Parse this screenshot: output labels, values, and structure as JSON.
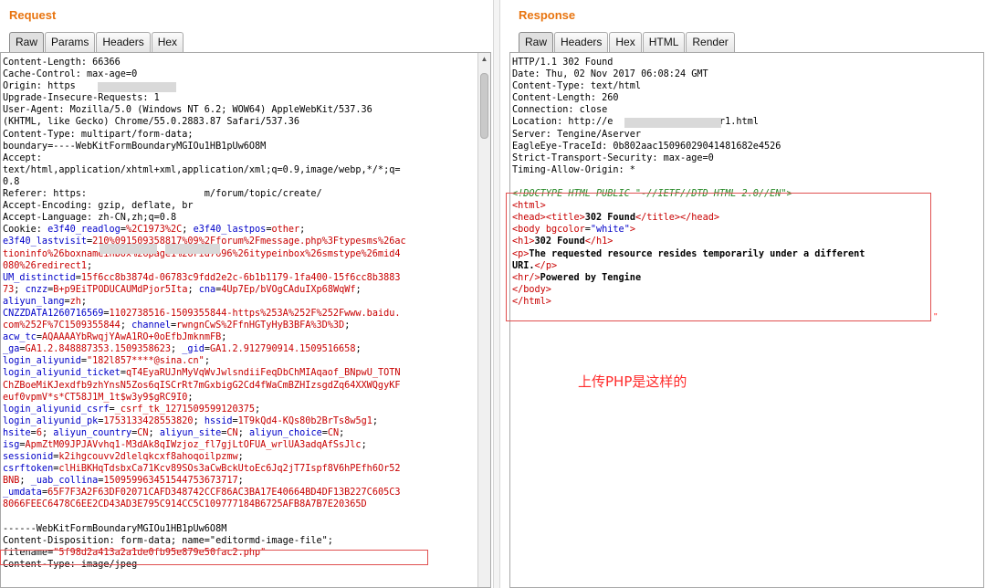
{
  "request": {
    "title": "Request",
    "tabs": [
      "Raw",
      "Params",
      "Headers",
      "Hex"
    ],
    "active_tab": "Raw",
    "lines": [
      [
        {
          "t": "Content-Length: 66366"
        }
      ],
      [
        {
          "t": "Cache-Control: max-age=0"
        }
      ],
      [
        {
          "t": "Origin: https          n.com"
        }
      ],
      [
        {
          "t": "Upgrade-Insecure-Requests: 1"
        }
      ],
      [
        {
          "t": "User-Agent: Mozilla/5.0 (Windows NT 6.2; WOW64) AppleWebKit/537.36"
        }
      ],
      [
        {
          "t": "(KHTML, like Gecko) Chrome/55.0.2883.87 Safari/537.36"
        }
      ],
      [
        {
          "t": "Content-Type: multipart/form-data;"
        }
      ],
      [
        {
          "t": "boundary=----WebKitFormBoundaryMGIOu1HB1pUw6O8M"
        }
      ],
      [
        {
          "t": "Accept:"
        }
      ],
      [
        {
          "t": "text/html,application/xhtml+xml,application/xml;q=0.9,image/webp,*/*;q="
        }
      ],
      [
        {
          "t": "0.8"
        }
      ],
      [
        {
          "t": "Referer: https:                     m/forum/topic/create/"
        }
      ],
      [
        {
          "t": "Accept-Encoding: gzip, deflate, br"
        }
      ],
      [
        {
          "t": "Accept-Language: zh-CN,zh;q=0.8"
        }
      ],
      [
        {
          "t": "Cookie: "
        },
        {
          "t": "e3f40_readlog",
          "c": "blue"
        },
        {
          "t": "=",
          "c": "k"
        },
        {
          "t": "%2C1973%2C",
          "c": "red"
        },
        {
          "t": "; "
        },
        {
          "t": "e3f40_lastpos",
          "c": "blue"
        },
        {
          "t": "="
        },
        {
          "t": "other",
          "c": "red"
        },
        {
          "t": ";"
        }
      ],
      [
        {
          "t": "e3f40_lastvisit",
          "c": "blue"
        },
        {
          "t": "="
        },
        {
          "t": "210%091509358817%09%2Fforum%2Fmessage.php%3Ftypesms%26ac",
          "c": "red"
        }
      ],
      [
        {
          "t": "tioninfo%26boxnameinbox%26page1%26rid7696%26itypeinbox%26smstype%26mid4",
          "c": "red"
        }
      ],
      [
        {
          "t": "080%26redirect1",
          "c": "red"
        },
        {
          "t": ";"
        }
      ],
      [
        {
          "t": "UM_distinctid",
          "c": "blue"
        },
        {
          "t": "="
        },
        {
          "t": "15f6cc8b3874d-06783c9fdd2e2c-6b1b1179-1fa400-15f6cc8b3883",
          "c": "red"
        }
      ],
      [
        {
          "t": "73",
          "c": "red"
        },
        {
          "t": "; "
        },
        {
          "t": "cnzz",
          "c": "blue"
        },
        {
          "t": "="
        },
        {
          "t": "B+p9EiTPODUCAUMdPjor5Ita",
          "c": "red"
        },
        {
          "t": "; "
        },
        {
          "t": "cna",
          "c": "blue"
        },
        {
          "t": "="
        },
        {
          "t": "4Up7Ep/bVOgCAduIXp68WqWf",
          "c": "red"
        },
        {
          "t": ";"
        }
      ],
      [
        {
          "t": "aliyun_lang",
          "c": "blue"
        },
        {
          "t": "="
        },
        {
          "t": "zh",
          "c": "red"
        },
        {
          "t": ";"
        }
      ],
      [
        {
          "t": "CNZZDATA1260716569",
          "c": "blue"
        },
        {
          "t": "="
        },
        {
          "t": "1102738516-1509355844-https%253A%252F%252Fwww.baidu.",
          "c": "red"
        }
      ],
      [
        {
          "t": "com%252F%7C1509355844",
          "c": "red"
        },
        {
          "t": "; "
        },
        {
          "t": "channel",
          "c": "blue"
        },
        {
          "t": "="
        },
        {
          "t": "rwngnCwS%2FfnHGTyHyB3BFA%3D%3D",
          "c": "red"
        },
        {
          "t": ";"
        }
      ],
      [
        {
          "t": "acw_tc",
          "c": "blue"
        },
        {
          "t": "="
        },
        {
          "t": "AQAAAAYbRwqjYAwA1RO+0oEfbJmknmFB",
          "c": "red"
        },
        {
          "t": ";"
        }
      ],
      [
        {
          "t": "_ga",
          "c": "blue"
        },
        {
          "t": "="
        },
        {
          "t": "GA1.2.848887353.1509358623",
          "c": "red"
        },
        {
          "t": "; "
        },
        {
          "t": "_gid",
          "c": "blue"
        },
        {
          "t": "="
        },
        {
          "t": "GA1.2.912790914.1509516658",
          "c": "red"
        },
        {
          "t": ";"
        }
      ],
      [
        {
          "t": "login_aliyunid",
          "c": "blue"
        },
        {
          "t": "="
        },
        {
          "t": "\"182l857****@sina.cn\"",
          "c": "red"
        },
        {
          "t": ";"
        }
      ],
      [
        {
          "t": "login_aliyunid_ticket",
          "c": "blue"
        },
        {
          "t": "="
        },
        {
          "t": "qT4EyaRUJnMyVqWvJwlsndiiFeqDbChMIAqaof_BNpwU_TOTN",
          "c": "red"
        }
      ],
      [
        {
          "t": "ChZBoeMiKJexdfb9zhYnsN5Zos6qISCrRt7mGxbigG2Cd4fWaCmBZHIzsgdZq64XXWQgyKF",
          "c": "red"
        }
      ],
      [
        {
          "t": "euf0vpmV*s*CT58J1M_1t$w3y9$gRC9I0",
          "c": "red"
        },
        {
          "t": ";"
        }
      ],
      [
        {
          "t": "login_aliyunid_csrf",
          "c": "blue"
        },
        {
          "t": "="
        },
        {
          "t": "_csrf_tk_1271509599120375",
          "c": "red"
        },
        {
          "t": ";"
        }
      ],
      [
        {
          "t": "login_aliyunid_pk",
          "c": "blue"
        },
        {
          "t": "="
        },
        {
          "t": "1753133428553820",
          "c": "red"
        },
        {
          "t": "; "
        },
        {
          "t": "hssid",
          "c": "blue"
        },
        {
          "t": "="
        },
        {
          "t": "1T9kQd4-KQs80b2BrTs8w5g1",
          "c": "red"
        },
        {
          "t": ";"
        }
      ],
      [
        {
          "t": "hsite",
          "c": "blue"
        },
        {
          "t": "="
        },
        {
          "t": "6",
          "c": "red"
        },
        {
          "t": "; "
        },
        {
          "t": "aliyun_country",
          "c": "blue"
        },
        {
          "t": "="
        },
        {
          "t": "CN",
          "c": "red"
        },
        {
          "t": "; "
        },
        {
          "t": "aliyun_site",
          "c": "blue"
        },
        {
          "t": "="
        },
        {
          "t": "CN",
          "c": "red"
        },
        {
          "t": "; "
        },
        {
          "t": "aliyun_choice",
          "c": "blue"
        },
        {
          "t": "="
        },
        {
          "t": "CN",
          "c": "red"
        },
        {
          "t": ";"
        }
      ],
      [
        {
          "t": "isg",
          "c": "blue"
        },
        {
          "t": "="
        },
        {
          "t": "ApmZtM09JPJAVvhq1-M3dAk8qIWzjoz_fl7gjLtOFUA_wrlUA3adqAfSsJlc",
          "c": "red"
        },
        {
          "t": ";"
        }
      ],
      [
        {
          "t": "sessionid",
          "c": "blue"
        },
        {
          "t": "="
        },
        {
          "t": "k2ihgcouvv2dlelqkcxf8ahoqoilpzmw",
          "c": "red"
        },
        {
          "t": ";"
        }
      ],
      [
        {
          "t": "csrftoken",
          "c": "blue"
        },
        {
          "t": "="
        },
        {
          "t": "clHiBKHqTdsbxCa71Kcv89SOs3aCwBckUtoEc6Jq2jT7Ispf8V6hPEfh6Or52",
          "c": "red"
        }
      ],
      [
        {
          "t": "BNB",
          "c": "red"
        },
        {
          "t": "; "
        },
        {
          "t": "_uab_collina",
          "c": "blue"
        },
        {
          "t": "="
        },
        {
          "t": "150959963451544753673717",
          "c": "red"
        },
        {
          "t": ";"
        }
      ],
      [
        {
          "t": "_umdata",
          "c": "blue"
        },
        {
          "t": "="
        },
        {
          "t": "65F7F3A2F63DF02071CAFD348742CCF86AC3BA17E40664BD4DF13B227C605C3",
          "c": "red"
        }
      ],
      [
        {
          "t": "8066FEEC6478C6EE2CD43AD3E795C914CC5C109777184B6725AFB8A7B7E20365D",
          "c": "red"
        }
      ],
      [
        {
          "t": ""
        }
      ],
      [
        {
          "t": "------WebKitFormBoundaryMGIOu1HB1pUw6O8M"
        }
      ],
      [
        {
          "t": "Content-Disposition: form-data; name=\"editormd-image-file\";"
        }
      ],
      [
        {
          "t": "filename="
        },
        {
          "t": "\"5f98d2a413a2a1de0fb95e879e50fac2.php\"",
          "c": "red"
        }
      ],
      [
        {
          "t": "Content-Type: image/jpeg"
        }
      ]
    ]
  },
  "response": {
    "title": "Response",
    "tabs": [
      "Raw",
      "Headers",
      "Hex",
      "HTML",
      "Render"
    ],
    "active_tab": "Raw",
    "lines": [
      [
        {
          "t": "HTTP/1.1 302 Found"
        }
      ],
      [
        {
          "t": "Date: Thu, 02 Nov 2017 06:08:24 GMT"
        }
      ],
      [
        {
          "t": "Content-Type: text/html"
        }
      ],
      [
        {
          "t": "Content-Length: 260"
        }
      ],
      [
        {
          "t": "Connection: close"
        }
      ],
      [
        {
          "t": "Location: http://e               error1.html"
        }
      ],
      [
        {
          "t": "Server: Tengine/Aserver"
        }
      ],
      [
        {
          "t": "EagleEye-TraceId: 0b802aac15096029041481682e4526"
        }
      ],
      [
        {
          "t": "Strict-Transport-Security: max-age=0"
        }
      ],
      [
        {
          "t": "Timing-Allow-Origin: *"
        }
      ],
      [
        {
          "t": ""
        }
      ],
      [
        {
          "t": "<!DOCTYPE HTML PUBLIC \"-//IETF//DTD HTML 2.0//EN\">",
          "c": "green"
        }
      ],
      [
        {
          "t": "<html>",
          "c": "red"
        }
      ],
      [
        {
          "t": "<head>",
          "c": "red"
        },
        {
          "t": "<title>",
          "c": "red"
        },
        {
          "t": "302 Found",
          "c": "b"
        },
        {
          "t": "</title>",
          "c": "red"
        },
        {
          "t": "</head>",
          "c": "red"
        }
      ],
      [
        {
          "t": "<body ",
          "c": "red"
        },
        {
          "t": "bgcolor",
          "c": "red"
        },
        {
          "t": "=",
          "c": "k"
        },
        {
          "t": "\"white\"",
          "c": "blue"
        },
        {
          "t": ">",
          "c": "red"
        }
      ],
      [
        {
          "t": "<h1>",
          "c": "red"
        },
        {
          "t": "302 Found",
          "c": "b"
        },
        {
          "t": "</h1>",
          "c": "red"
        }
      ],
      [
        {
          "t": "<p>",
          "c": "red"
        },
        {
          "t": "The requested resource resides temporarily under a different",
          "c": "b"
        }
      ],
      [
        {
          "t": "URI.",
          "c": "b"
        },
        {
          "t": "</p>",
          "c": "red"
        }
      ],
      [
        {
          "t": "<hr/>",
          "c": "red"
        },
        {
          "t": "Powered by Tengine",
          "c": "b"
        }
      ],
      [
        {
          "t": "</body>",
          "c": "red"
        }
      ],
      [
        {
          "t": "</html>",
          "c": "red"
        }
      ]
    ]
  },
  "annotation": {
    "caption": "上传PHP是这样的",
    "dot": "\""
  },
  "colors": {
    "accent_title": "#e8740f",
    "param_name": "#0000c8",
    "param_value": "#c80000",
    "annotation": "#ff2a2a"
  }
}
